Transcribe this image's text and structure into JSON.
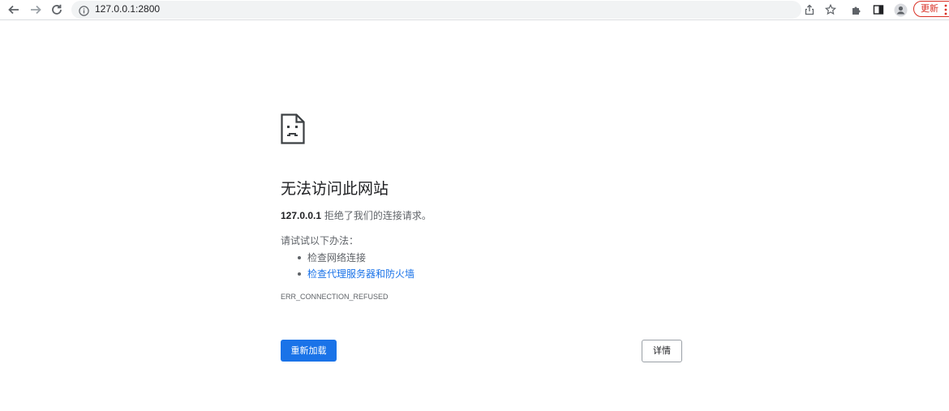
{
  "browser": {
    "url": "127.0.0.1:2800",
    "update_label": "更新",
    "icons": [
      "back-icon",
      "forward-icon",
      "reload-icon",
      "info-icon",
      "share-icon",
      "star-icon",
      "extensions-icon",
      "side-panel-icon",
      "profile-icon",
      "menu-icon"
    ]
  },
  "error_page": {
    "title": "无法访问此网站",
    "host": "127.0.0.1",
    "message": " 拒绝了我们的连接请求。",
    "suggestions_heading": "请试试以下办法：",
    "suggestions": [
      "检查网络连接",
      "检查代理服务器和防火墙"
    ],
    "error_code": "ERR_CONNECTION_REFUSED",
    "reload_label": "重新加载",
    "details_label": "详情"
  },
  "colors": {
    "primary": "#1a73e8",
    "text": "#202124",
    "secondary": "#5f6368",
    "update": "#d93025"
  }
}
